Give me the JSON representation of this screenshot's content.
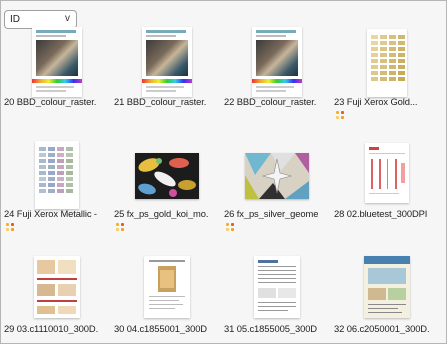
{
  "sort": {
    "value": "ID",
    "chevron": "v"
  },
  "items": [
    {
      "label": "20  BBD_colour_raster.",
      "badge": false
    },
    {
      "label": "21  BBD_colour_raster.",
      "badge": false
    },
    {
      "label": "22  BBD_colour_raster.",
      "badge": false
    },
    {
      "label": "23  Fuji Xerox Gold...",
      "badge": true
    },
    {
      "label": "24  Fuji Xerox Metallic -",
      "badge": true
    },
    {
      "label": "25  fx_ps_gold_koi_mo.",
      "badge": true
    },
    {
      "label": "26  fx_ps_silver_geome",
      "badge": true
    },
    {
      "label": "28  02.bluetest_300DPI",
      "badge": false
    },
    {
      "label": "29  03.c1110010_300D.",
      "badge": false
    },
    {
      "label": "30  04.c1855001_300D",
      "badge": false
    },
    {
      "label": "31  05.c1855005_300D",
      "badge": false
    },
    {
      "label": "32  06.c2050001_300D.",
      "badge": false
    }
  ],
  "colors": {
    "badge": [
      "#f0b030",
      "#e06020",
      "#f5d060",
      "#f0a020"
    ]
  }
}
